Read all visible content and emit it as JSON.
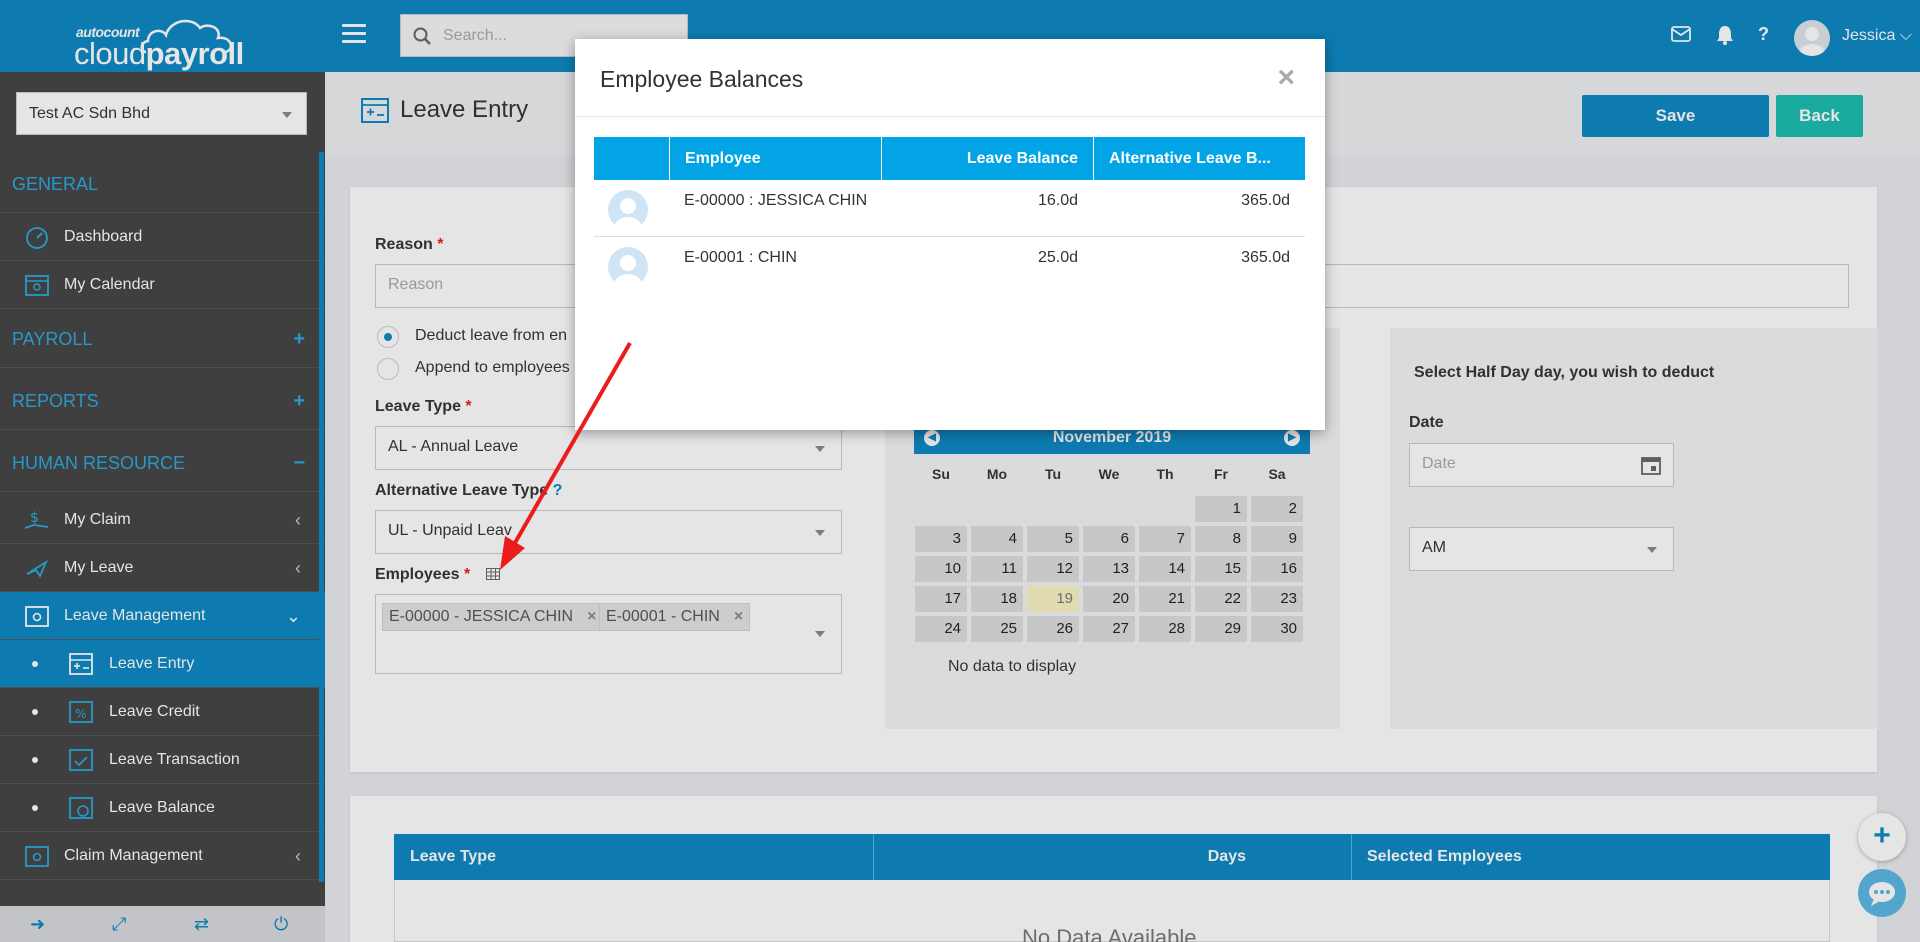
{
  "brand": {
    "small": "autocount",
    "big_light": "cloud",
    "big_bold": "payroll"
  },
  "search": {
    "placeholder": "Search..."
  },
  "user": {
    "name": "Jessica"
  },
  "company": {
    "selected": "Test AC Sdn Bhd"
  },
  "sidebar": {
    "sections": {
      "general": "GENERAL",
      "payroll": "PAYROLL",
      "reports": "REPORTS",
      "hr": "HUMAN RESOURCE"
    },
    "items": {
      "dashboard": "Dashboard",
      "my_calendar": "My Calendar",
      "my_claim": "My Claim",
      "my_leave": "My Leave",
      "leave_management": "Leave Management",
      "leave_entry": "Leave Entry",
      "leave_credit": "Leave Credit",
      "leave_transaction": "Leave Transaction",
      "leave_balance": "Leave Balance",
      "claim_management": "Claim Management"
    }
  },
  "page": {
    "title": "Leave Entry",
    "save_label": "Save",
    "back_label": "Back"
  },
  "form": {
    "reason_label": "Reason",
    "reason_placeholder": "Reason",
    "radio_deduct": "Deduct leave from en",
    "radio_append": "Append to employees",
    "leave_type_label": "Leave Type",
    "leave_type_value": "AL - Annual Leave",
    "alt_leave_type_label": "Alternative Leave Type",
    "alt_leave_type_value": "UL - Unpaid Leav",
    "employees_label": "Employees",
    "employees": [
      "E-00000 - JESSICA CHIN",
      "E-00001 - CHIN"
    ],
    "required_mark": "*",
    "help_mark": "?"
  },
  "calendar": {
    "month": "November 2019",
    "dow": [
      "Su",
      "Mo",
      "Tu",
      "We",
      "Th",
      "Fr",
      "Sa"
    ],
    "days": [
      [
        "",
        "",
        "",
        "",
        "",
        "1",
        "2"
      ],
      [
        "3",
        "4",
        "5",
        "6",
        "7",
        "8",
        "9"
      ],
      [
        "10",
        "11",
        "12",
        "13",
        "14",
        "15",
        "16"
      ],
      [
        "17",
        "18",
        "19",
        "20",
        "21",
        "22",
        "23"
      ],
      [
        "24",
        "25",
        "26",
        "27",
        "28",
        "29",
        "30"
      ]
    ],
    "today": "19",
    "no_data": "No data to display"
  },
  "half_day": {
    "title": "Select Half Day day, you wish to deduct",
    "date_label": "Date",
    "date_placeholder": "Date",
    "period_value": "AM"
  },
  "summary_table": {
    "headers": [
      "Leave Type",
      "Days",
      "Selected Employees"
    ],
    "empty": "No Data Available"
  },
  "modal": {
    "title": "Employee Balances",
    "close": "×",
    "headers": [
      "Employee",
      "Leave Balance",
      "Alternative Leave B..."
    ],
    "rows": [
      {
        "employee": "E-00000 : JESSICA CHIN",
        "leave_balance": "16.0d",
        "alt_balance": "365.0d"
      },
      {
        "employee": "E-00001 : CHIN",
        "leave_balance": "25.0d",
        "alt_balance": "365.0d"
      }
    ]
  },
  "colors": {
    "primary": "#0a87c3",
    "teal": "#1abcb0",
    "modal_header": "#03a4e6",
    "arrow": "#ea1c1c"
  }
}
